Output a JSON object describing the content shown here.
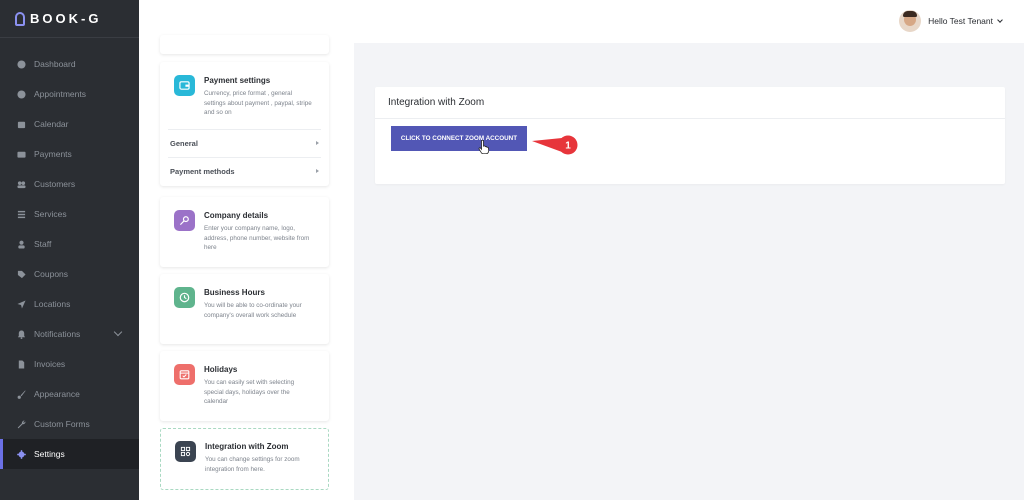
{
  "brand": {
    "name": "BOOK-G"
  },
  "sidebar": {
    "items": [
      {
        "label": "Dashboard",
        "icon": "dashboard-icon"
      },
      {
        "label": "Appointments",
        "icon": "clock-icon"
      },
      {
        "label": "Calendar",
        "icon": "calendar-icon"
      },
      {
        "label": "Payments",
        "icon": "payments-icon"
      },
      {
        "label": "Customers",
        "icon": "users-icon"
      },
      {
        "label": "Services",
        "icon": "list-icon"
      },
      {
        "label": "Staff",
        "icon": "person-icon"
      },
      {
        "label": "Coupons",
        "icon": "tag-icon"
      },
      {
        "label": "Locations",
        "icon": "location-arrow-icon"
      },
      {
        "label": "Notifications",
        "icon": "bell-icon"
      },
      {
        "label": "Invoices",
        "icon": "file-icon"
      },
      {
        "label": "Appearance",
        "icon": "brush-icon"
      },
      {
        "label": "Custom Forms",
        "icon": "wrench-icon"
      },
      {
        "label": "Settings",
        "icon": "gear-icon",
        "active": true
      }
    ]
  },
  "topbar": {
    "user_greeting": "Hello Test Tenant"
  },
  "settings": {
    "payment": {
      "title": "Payment settings",
      "description": "Currency, price format , general settings about payment , paypal, stripe and so on",
      "sub_items": [
        "General",
        "Payment methods"
      ]
    },
    "company": {
      "title": "Company details",
      "description": "Enter your company name, logo, address, phone number, website from here"
    },
    "business_hours": {
      "title": "Business Hours",
      "description": "You will be able to co-ordinate your company's overall work schedule"
    },
    "holidays": {
      "title": "Holidays",
      "description": "You can easily set with selecting special days, holidays over the calendar"
    },
    "zoom": {
      "title": "Integration with Zoom",
      "description": "You can change settings for zoom integration from here."
    }
  },
  "main": {
    "title": "Integration with Zoom",
    "connect_button": "CLICK TO CONNECT ZOOM ACCOUNT"
  },
  "callout": {
    "number": "1"
  },
  "colors": {
    "sidebar_bg": "#2b2e33",
    "accent": "#5257b5",
    "payment_icon": "#29b8d8",
    "company_icon": "#9b72c8",
    "hours_icon": "#5fb48d",
    "holidays_icon": "#ee6f6b",
    "zoom_icon": "#3b4451",
    "callout": "#e7353b"
  }
}
